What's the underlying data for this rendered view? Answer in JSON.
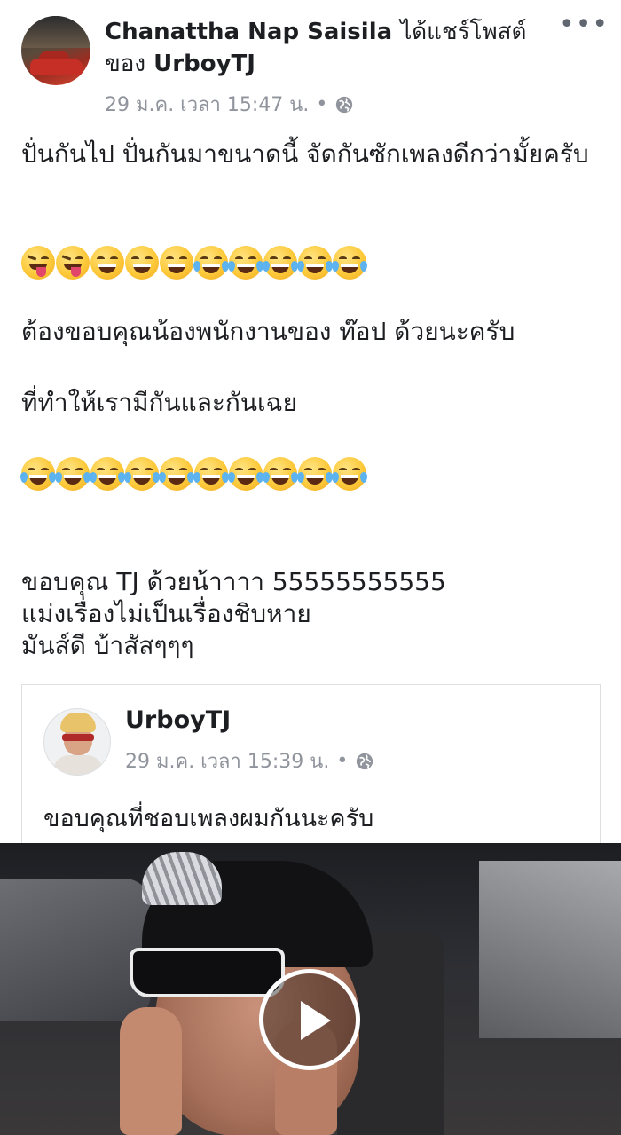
{
  "post": {
    "author": "Chanattha Nap Saisila",
    "shared_verb": "ได้แชร์โพสต์",
    "of_word": "ของ",
    "shared_from": "UrboyTJ",
    "timestamp": "29 ม.ค. เวลา 15:47 น.",
    "separator": "•",
    "more_icon": "more-horizontal-icon",
    "privacy_icon": "globe-icon",
    "paragraphs": {
      "p1": "ปั่นกันไป ปั่นกันมาขนาดนี้ จัดกันซักเพลงดีกว่ามั้ยครับ",
      "p2": "ต้องขอบคุณน้องพนักงานของ ท๊อป ด้วยนะครับ",
      "p3": "ที่ทำให้เรามีกันและกันเฉย",
      "p4_line1": "ขอบคุณ TJ ด้วยน้าาาา 55555555555",
      "p4_line2": "แม่งเรื่องไม่เป็นเรื่องชิบหาย",
      "p4_line3": "มันส์ดี บ้าสัสๆๆๆ"
    },
    "emoji_row_1": [
      "stuck-out-tongue-winking",
      "stuck-out-tongue-winking",
      "grinning",
      "grinning",
      "grinning",
      "joy",
      "joy",
      "joy",
      "joy",
      "joy"
    ],
    "emoji_row_2": [
      "joy",
      "joy",
      "joy",
      "joy",
      "joy",
      "joy",
      "joy",
      "joy",
      "joy",
      "joy"
    ]
  },
  "shared_post": {
    "author": "UrboyTJ",
    "timestamp": "29 ม.ค. เวลา 15:39 น.",
    "separator": "•",
    "privacy_icon": "globe-icon",
    "text": "ขอบคุณที่ชอบเพลงผมกันนะครับ"
  },
  "video": {
    "play_icon": "play-icon"
  },
  "colors": {
    "text_primary": "#1c1e21",
    "text_meta": "#90949c",
    "border": "#dddfe2"
  }
}
